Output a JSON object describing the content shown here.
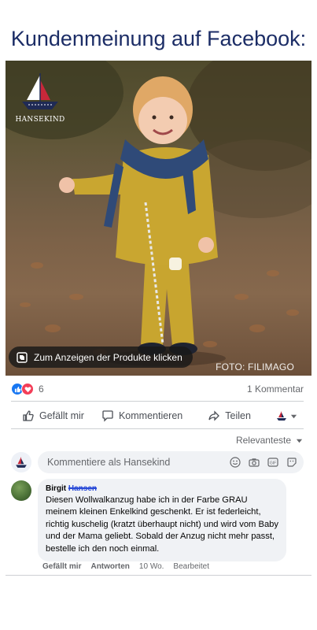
{
  "headline": "Kundenmeinung auf Facebook:",
  "post_image": {
    "brand_name": "HANSEKIND",
    "product_tag_label": "Zum Anzeigen der Produkte klicken",
    "photo_credit": "FOTO: FILIMAGO"
  },
  "reactions": {
    "count": "6",
    "comments_count": "1 Kommentar",
    "like_color": "#1877f2",
    "love_color": "#f33e58"
  },
  "actions": {
    "like": "Gefällt mir",
    "comment": "Kommentieren",
    "share": "Teilen"
  },
  "comments_sort": "Relevanteste",
  "compose": {
    "placeholder": "Kommentiere als Hansekind"
  },
  "comment": {
    "author_first": "Birgit",
    "author_last_redacted": "Hansen",
    "text": "Diesen Wollwalkanzug habe ich in der Farbe GRAU meinem kleinen Enkelkind geschenkt. Er ist federleicht, richtig kuschelig (kratzt überhaupt nicht) und wird vom Baby und der Mama geliebt. Sobald der Anzug nicht mehr passt, bestelle ich den noch einmal.",
    "like": "Gefällt mir",
    "reply": "Antworten",
    "age": "10 Wo.",
    "edited": "Bearbeitet"
  }
}
